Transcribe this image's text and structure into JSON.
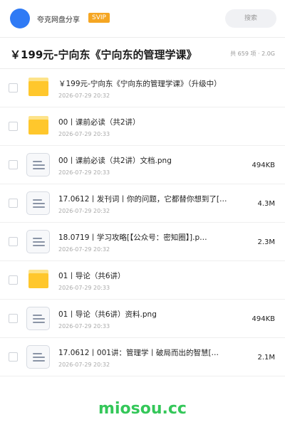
{
  "topbar": {
    "site_name": "夸克网盘分享",
    "badge": "SVIP",
    "search_placeholder": "搜索"
  },
  "header": {
    "title": "￥199元-宁向东《宁向东的管理学课》",
    "meta": "共 659 项 · 2.0G"
  },
  "files": [
    {
      "type": "folder",
      "name": "￥199元-宁向东《宁向东的管理学课》（升级中）",
      "date": "2026-07-29 20:32",
      "size": ""
    },
    {
      "type": "folder",
      "name": "00丨课前必读（共2讲）",
      "date": "2026-07-29 20:33",
      "size": ""
    },
    {
      "type": "file",
      "name": "00丨课前必读（共2讲）文档.png",
      "date": "2026-07-29 20:33",
      "size": "494KB"
    },
    {
      "type": "file",
      "name": "17.0612丨发刊词丨你的问题，它都替你想到了[…",
      "date": "2026-07-29 20:32",
      "size": "4.3M"
    },
    {
      "type": "file",
      "name": "18.0719丨学习攻略[【公众号：密知圈】].p…",
      "date": "2026-07-29 20:32",
      "size": "2.3M"
    },
    {
      "type": "folder",
      "name": "01丨导论（共6讲）",
      "date": "2026-07-29 20:33",
      "size": ""
    },
    {
      "type": "file",
      "name": "01丨导论（共6讲）资料.png",
      "date": "2026-07-29 20:33",
      "size": "494KB"
    },
    {
      "type": "file",
      "name": "17.0612丨001讲：管理学丨破局而出的智慧[…",
      "date": "2026-07-29 20:32",
      "size": "2.1M"
    }
  ],
  "watermark": "miosou.cc",
  "colors": {
    "accent": "#2f7af5",
    "badge": "#f5a623",
    "folder": "#ffc72c",
    "watermark": "#34c759"
  }
}
